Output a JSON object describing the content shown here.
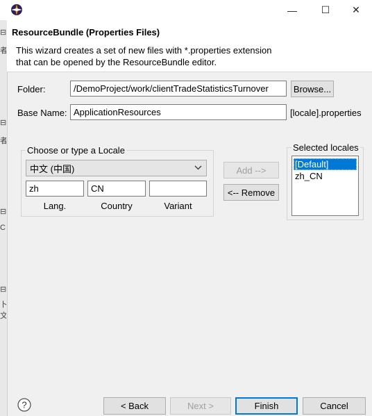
{
  "window": {
    "minimize_glyph": "—",
    "maximize_glyph": "☐",
    "close_glyph": "✕"
  },
  "background_window": {
    "markers": [
      "⊟",
      "者",
      "⊟",
      "者",
      "⊟",
      "C",
      "⊟",
      "卜文"
    ]
  },
  "header": {
    "title": "ResourceBundle (Properties Files)",
    "description": "This wizard creates a set of new files with *.properties extension\nthat can be opened by the ResourceBundle editor."
  },
  "form": {
    "folder_label": "Folder:",
    "folder_value": "/DemoProject/work/clientTradeStatisticsTurnover",
    "browse_label": "Browse...",
    "basename_label": "Base Name:",
    "basename_value": "ApplicationResources",
    "basename_suffix": "[locale].properties"
  },
  "locale_group": {
    "title": "Choose or type a Locale",
    "selected_locale": "中文 (中国)",
    "lang_value": "zh",
    "country_value": "CN",
    "variant_value": "",
    "lang_label": "Lang.",
    "country_label": "Country",
    "variant_label": "Variant"
  },
  "actions": {
    "add_label": "Add   -->",
    "remove_label": "<-- Remove"
  },
  "selected_locales": {
    "title": "Selected locales",
    "items": [
      "[Default]",
      "zh_CN"
    ],
    "selected_index": 0
  },
  "footer": {
    "back_label": "< Back",
    "next_label": "Next >",
    "finish_label": "Finish",
    "cancel_label": "Cancel"
  },
  "colors": {
    "selection": "#0078d7",
    "dialog_bg": "#f0f0f0"
  }
}
